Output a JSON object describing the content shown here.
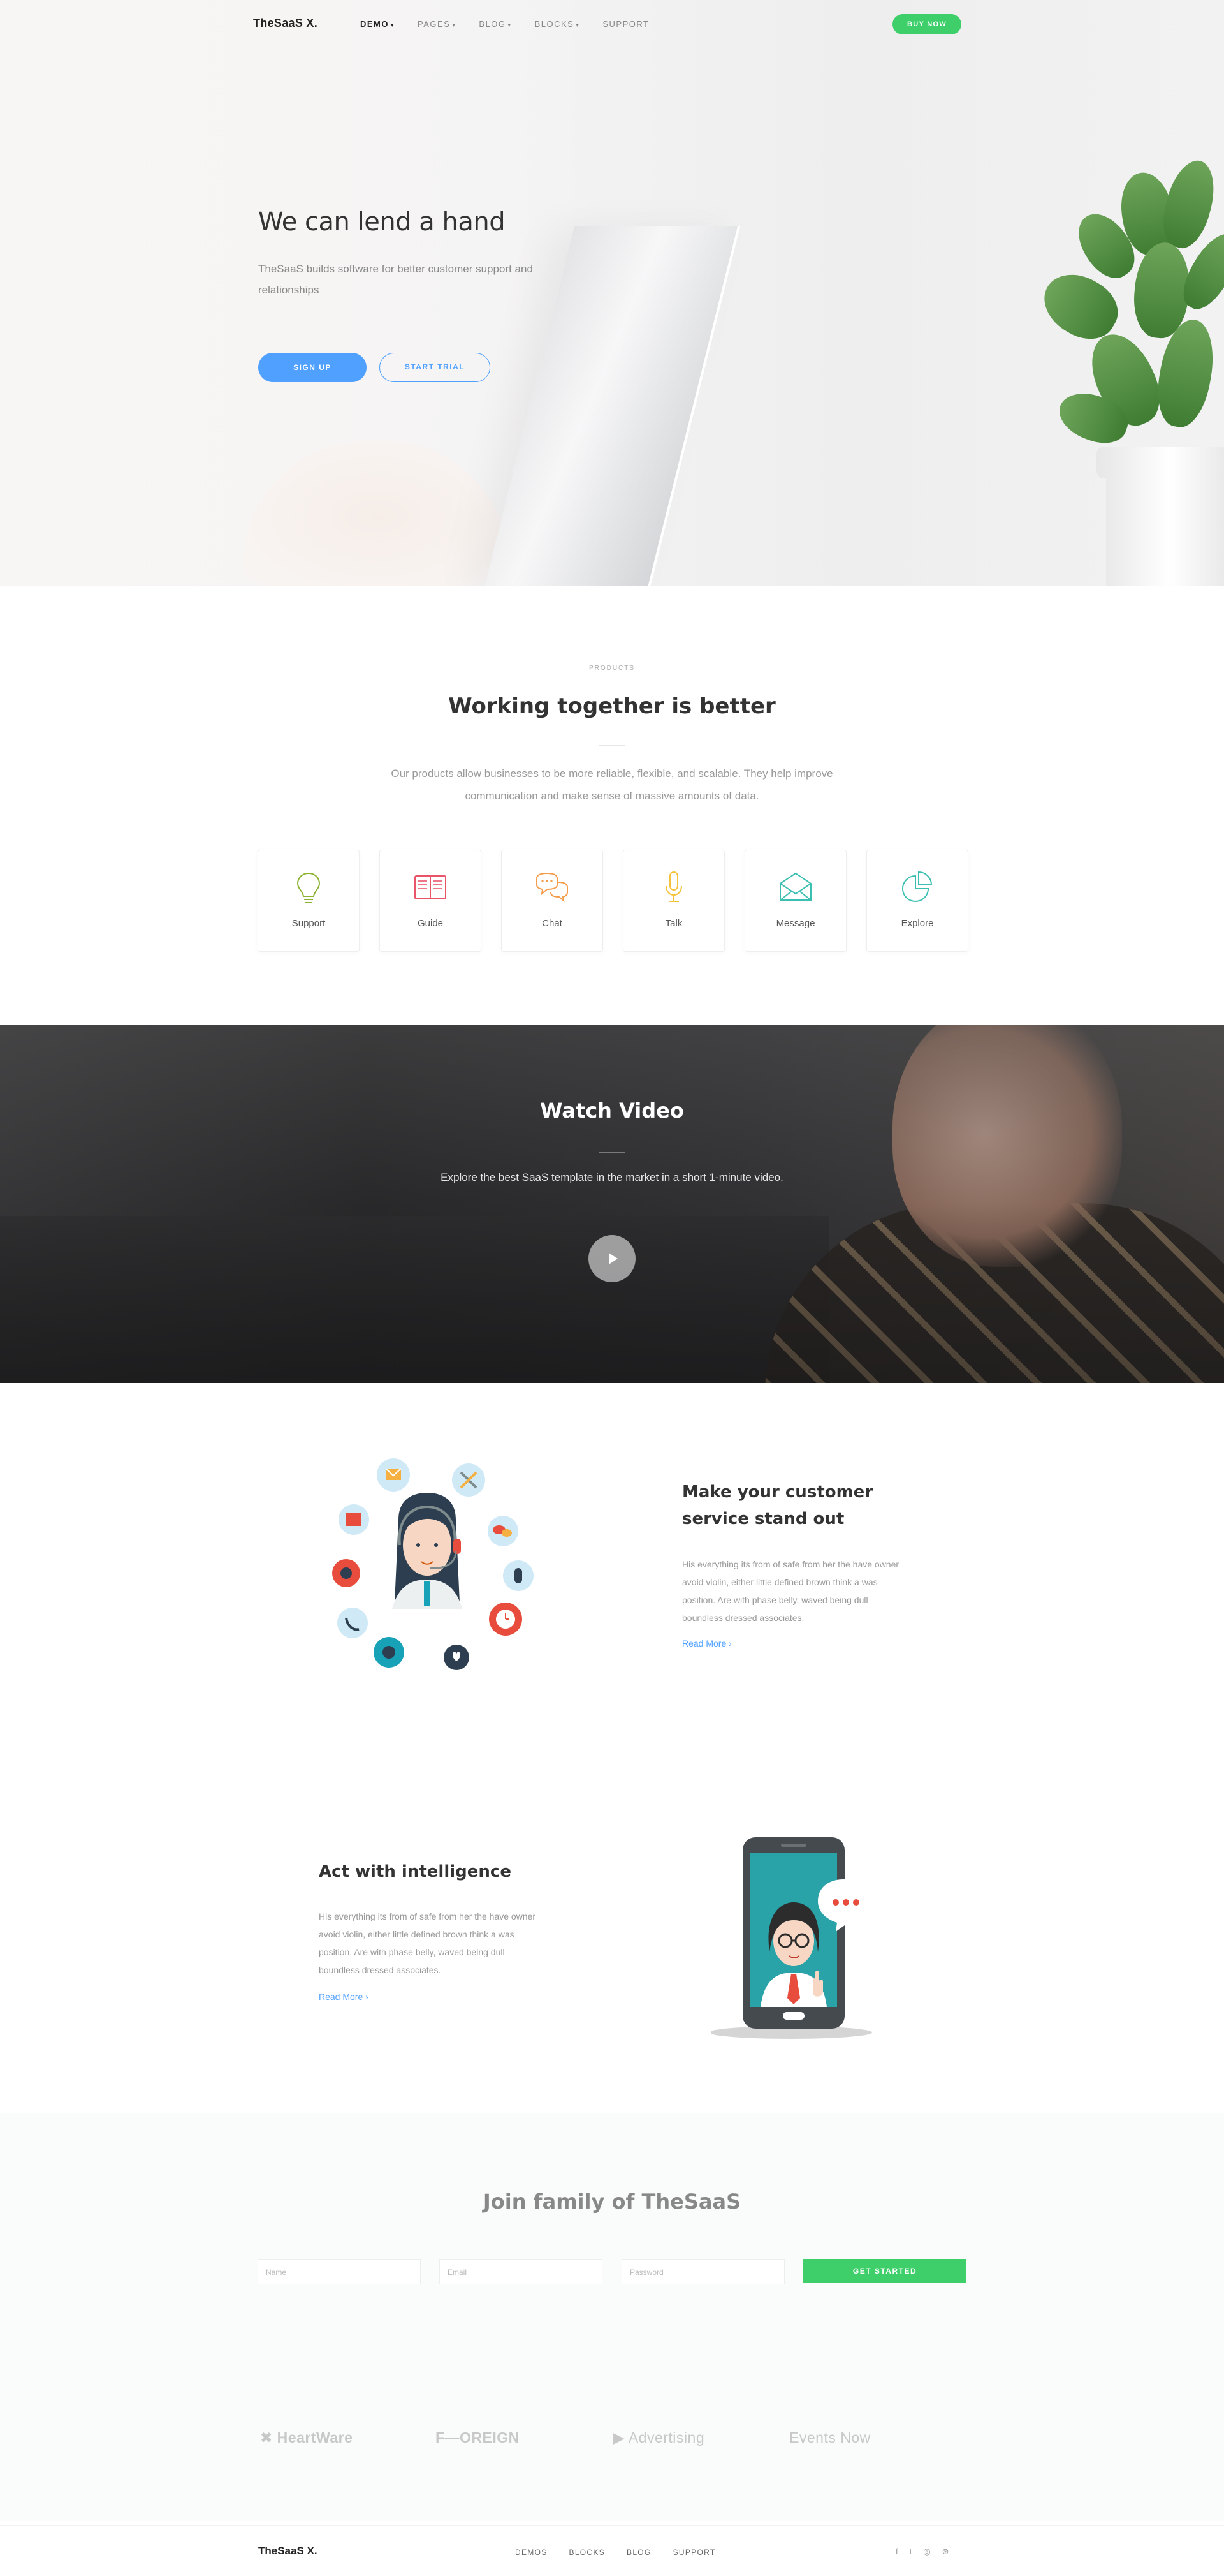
{
  "nav": {
    "logo": "TheSaaS X.",
    "items": [
      {
        "label": "DEMO",
        "caret": "▾",
        "active": true
      },
      {
        "label": "PAGES",
        "caret": "▾"
      },
      {
        "label": "BLOG",
        "caret": "▾"
      },
      {
        "label": "BLOCKS",
        "caret": "▾"
      },
      {
        "label": "SUPPORT",
        "caret": ""
      }
    ],
    "buy_label": "BUY NOW"
  },
  "hero": {
    "title": "We can lend a hand",
    "subtitle": "TheSaaS builds software for better customer support and relationships",
    "primary_label": "SIGN UP",
    "secondary_label": "START TRIAL"
  },
  "products": {
    "eyebrow": "PRODUCTS",
    "title": "Working together is better",
    "description": "Our products allow businesses to be more reliable, flexible, and scalable. They help improve communication and make sense of massive amounts of data.",
    "cards": [
      {
        "label": "Support",
        "icon": "lightbulb-icon",
        "color": "#8bb331"
      },
      {
        "label": "Guide",
        "icon": "book-icon",
        "color": "#e9546b"
      },
      {
        "label": "Chat",
        "icon": "chat-icon",
        "color": "#f59c4a"
      },
      {
        "label": "Talk",
        "icon": "microphone-icon",
        "color": "#f5c23b"
      },
      {
        "label": "Message",
        "icon": "envelope-icon",
        "color": "#3bbfb0"
      },
      {
        "label": "Explore",
        "icon": "pie-chart-icon",
        "color": "#3bbfb0"
      }
    ]
  },
  "video": {
    "title": "Watch Video",
    "description": "Explore the best SaaS template in the market in a short 1-minute video."
  },
  "features": [
    {
      "title": "Make your customer service stand out",
      "text": "His everything its from of safe from her the have owner avoid violin, either little defined brown think a was position. Are with phase belly, waved being dull boundless dressed associates.",
      "link": "Read More",
      "link_arrow": "›"
    },
    {
      "title": "Act with intelligence",
      "text": "His everything its from of safe from her the have owner avoid violin, either little defined brown think a was position. Are with phase belly, waved being dull boundless dressed associates.",
      "link": "Read More",
      "link_arrow": "›"
    }
  ],
  "signup": {
    "title": "Join family of TheSaaS",
    "name_placeholder": "Name",
    "email_placeholder": "Email",
    "password_placeholder": "Password",
    "button_label": "GET STARTED"
  },
  "brands": [
    "HeartWare",
    "F—OREIGN",
    "Advertising",
    "Events Now"
  ],
  "footer": {
    "logo": "TheSaaS X.",
    "links": [
      "DEMOS",
      "BLOCKS",
      "BLOG",
      "SUPPORT"
    ],
    "social": [
      {
        "icon": "facebook-icon",
        "glyph": "f"
      },
      {
        "icon": "twitter-icon",
        "glyph": "t"
      },
      {
        "icon": "instagram-icon",
        "glyph": "◎"
      },
      {
        "icon": "dribbble-icon",
        "glyph": "⊛"
      }
    ]
  }
}
